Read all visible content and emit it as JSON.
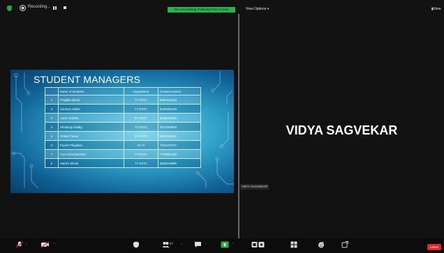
{
  "top_bar": {
    "recording_label": "Recording...",
    "sharing_banner": "You are viewing Prathvika Pai's screen",
    "view_options": "View Options ▾",
    "view_corner": "View"
  },
  "slide": {
    "title": "STUDENT MANAGERS",
    "columns": [
      "",
      "Name of Students",
      "Department",
      "Contact number"
    ],
    "rows": [
      {
        "num": "1",
        "name": "Prajakta Desai",
        "dept": "TY EXTC",
        "contact": "9594444348"
      },
      {
        "num": "2",
        "name": "Soumya Salian",
        "dept": "TY EXTC",
        "contact": "8169355249"
      },
      {
        "num": "3",
        "name": "Aryan Solanki",
        "dept": "SY EXTC",
        "contact": "8268410080"
      },
      {
        "num": "4",
        "name": "Shubangi Kadbg",
        "dept": "TY EXTC",
        "contact": "9137040918"
      },
      {
        "num": "5",
        "name": "Omkar Pawar",
        "dept": "SY EXTC",
        "contact": "8324189306"
      },
      {
        "num": "6",
        "name": "Piyush Phigalkar",
        "dept": "SY IT",
        "contact": "7020475727"
      },
      {
        "num": "7",
        "name": "Arya Chandanshive",
        "dept": "TY EXTC",
        "contact": "7700061689"
      },
      {
        "num": "8",
        "name": "Sakshi Shelar",
        "dept": "TY EXTC",
        "contact": "9920108889"
      }
    ]
  },
  "participant": {
    "display_name": "VIDYA SAGVEKAR",
    "name_tag": "VIDYA SAGVEKAR"
  },
  "toolbar": {
    "participants_count": "27",
    "leave_label": "Leave"
  },
  "colors": {
    "sharing_green": "#2db04a",
    "leave_red": "#e02828",
    "chat_active_green": "#2db04a"
  }
}
